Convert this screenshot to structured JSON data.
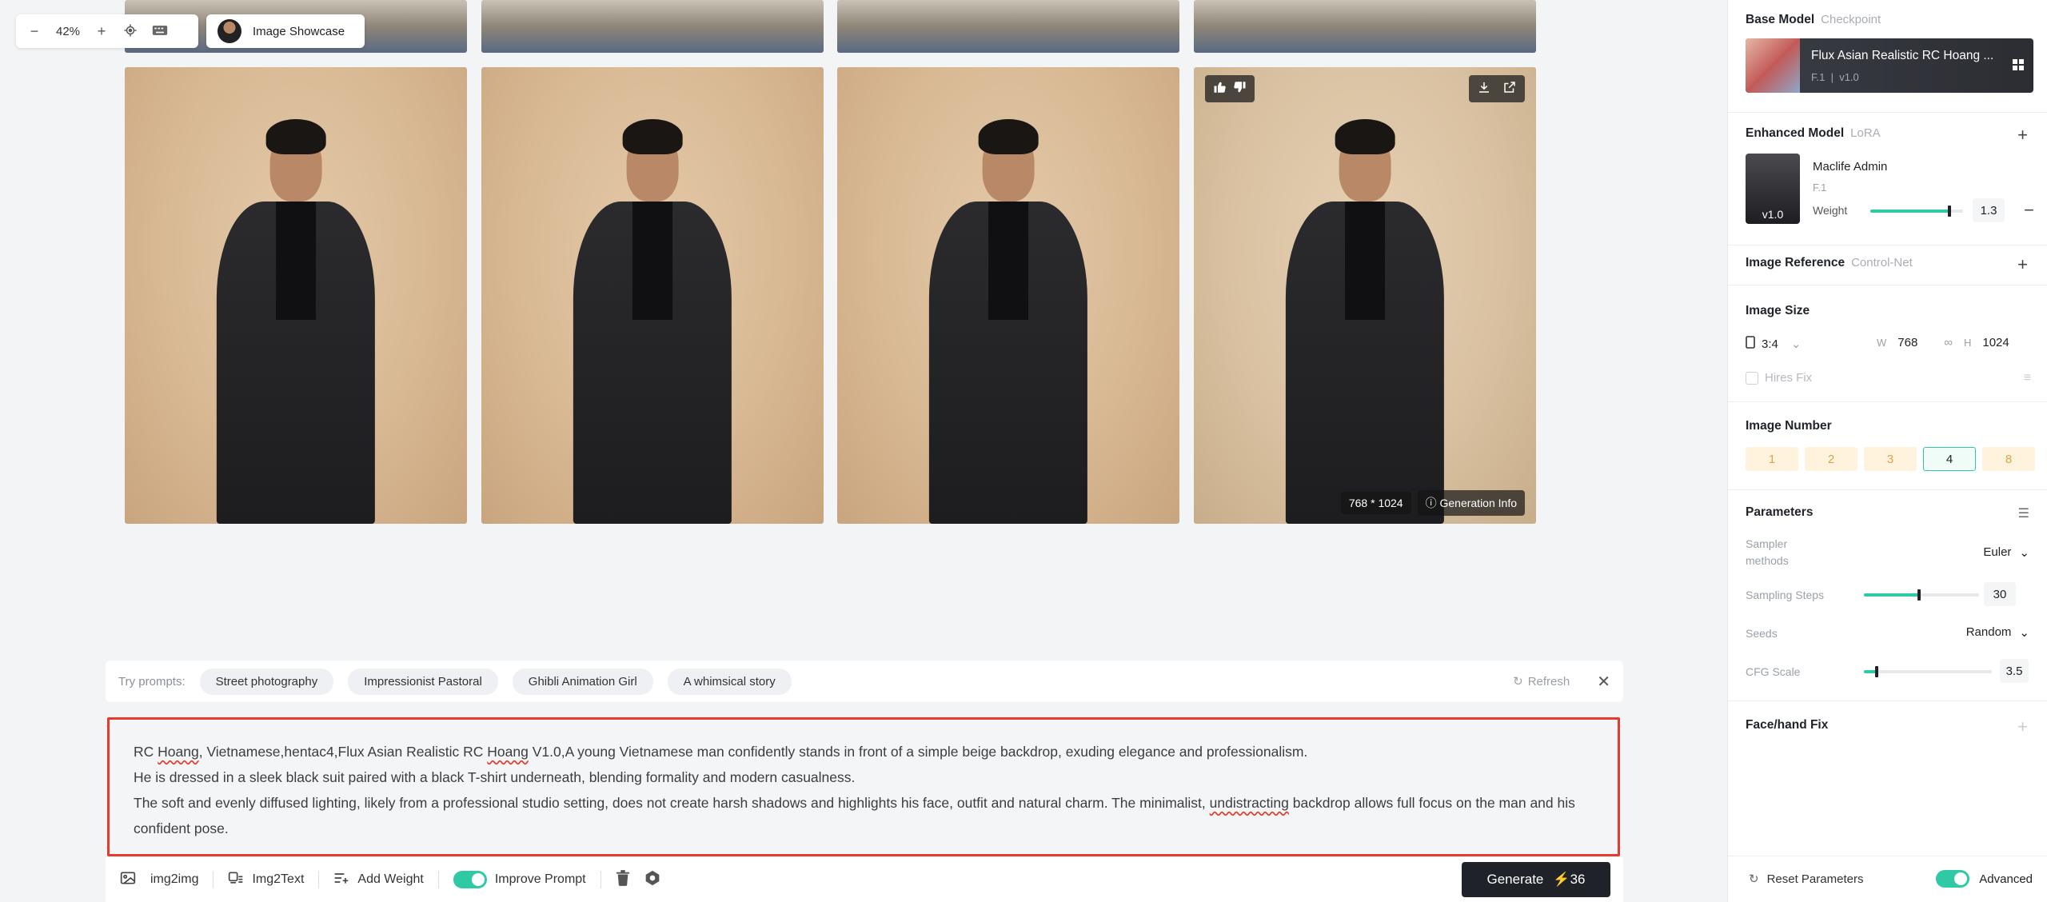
{
  "zoom": {
    "minus_icon": "minus-icon",
    "value": "42%",
    "plus_icon": "plus-icon"
  },
  "showcase": {
    "label": "Image Showcase"
  },
  "gallery": {
    "image_size": "768 * 1024",
    "generation_info": "Generation Info"
  },
  "prompts": {
    "label": "Try prompts:",
    "chips": [
      "Street photography",
      "Impressionist Pastoral",
      "Ghibli Animation Girl",
      "A whimsical story"
    ],
    "refresh": "Refresh"
  },
  "prompt_text": {
    "line1_a": "RC ",
    "line1_b": "Hoang",
    "line1_c": ", Vietnamese,hentac4,Flux Asian Realistic RC ",
    "line1_d": "Hoang",
    "line1_e": " V1.0,A young Vietnamese man confidently stands in front of a simple beige backdrop, exuding elegance and professionalism.",
    "line2": "He is dressed in a sleek black suit paired with a black T-shirt underneath, blending formality and modern casualness.",
    "line3_a": "The soft and evenly diffused lighting, likely from a professional studio setting, does not create harsh shadows and highlights his face, outfit and natural charm. The minimalist, ",
    "line3_b": "undistracting",
    "line3_c": " backdrop allows full focus on the man and his confident pose."
  },
  "bottombar": {
    "img2img": "img2img",
    "img2text": "Img2Text",
    "add_weight": "Add Weight",
    "improve_prompt": "Improve Prompt",
    "generate": "Generate",
    "cost": "36"
  },
  "panel": {
    "base_model": {
      "title": "Base Model",
      "sub": "Checkpoint",
      "name": "Flux Asian Realistic RC Hoang ...",
      "meta_a": "F.1",
      "meta_sep": "|",
      "meta_b": "v1.0"
    },
    "enhanced": {
      "title": "Enhanced Model",
      "sub": "LoRA",
      "name": "Maclife Admin",
      "base": "F.1",
      "version": "v1.0",
      "weight_label": "Weight",
      "weight": "1.3",
      "weight_fraction": 0.85
    },
    "image_reference": {
      "title": "Image Reference",
      "sub": "Control-Net"
    },
    "image_size": {
      "title": "Image Size",
      "ratio": "3:4",
      "w_label": "W",
      "w": "768",
      "h_label": "H",
      "h": "1024",
      "hires": "Hires Fix"
    },
    "image_number": {
      "title": "Image Number",
      "options": [
        "1",
        "2",
        "3",
        "4",
        "8"
      ],
      "selected": "4"
    },
    "parameters": {
      "title": "Parameters",
      "sampler_label_1": "Sampler",
      "sampler_label_2": "methods",
      "sampler": "Euler",
      "steps_label": "Sampling Steps",
      "steps": "30",
      "steps_fraction": 0.48,
      "seeds_label": "Seeds",
      "seeds": "Random",
      "cfg_label": "CFG Scale",
      "cfg": "3.5",
      "cfg_fraction": 0.1
    },
    "face_fix": {
      "title": "Face/hand Fix"
    },
    "footer": {
      "reset": "Reset Parameters",
      "advanced": "Advanced"
    }
  },
  "colors": {
    "accent": "#2fc9a6",
    "highlight_border": "#e53b2c",
    "generate_bg": "#1f2329"
  }
}
